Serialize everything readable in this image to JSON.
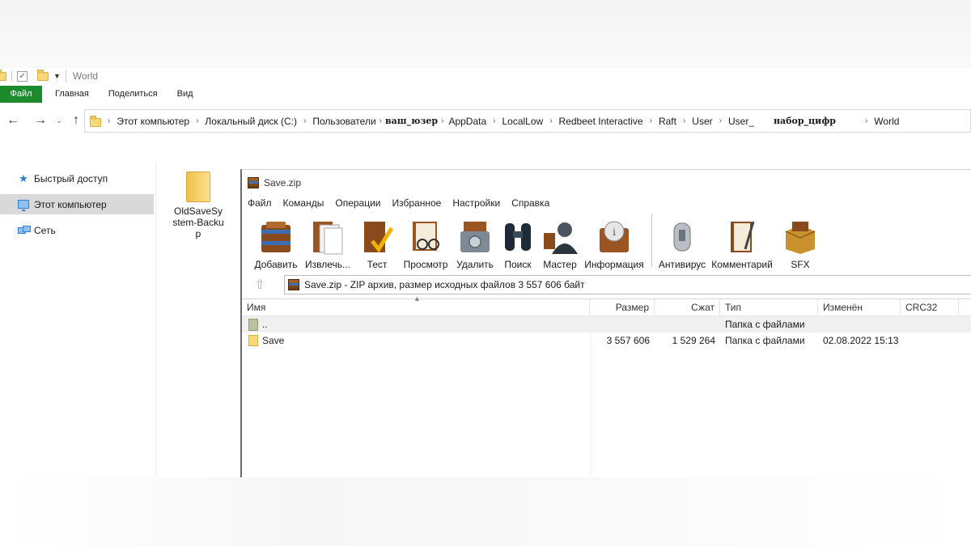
{
  "explorer": {
    "title": "World",
    "ribbon_tabs": [
      "Файл",
      "Главная",
      "Поделиться",
      "Вид"
    ],
    "breadcrumb": [
      "Этот компьютер",
      "Локальный диск (C:)",
      "Пользователи",
      "ваш_юзер",
      "AppData",
      "LocalLow",
      "Redbeet Interactive",
      "Raft",
      "User",
      "User_",
      "набор_цифр",
      "World"
    ],
    "nav_items": [
      "Быстрый доступ",
      "Этот компьютер",
      "Сеть"
    ],
    "folder_item_label": "OldSaveSystem-Backup"
  },
  "rar": {
    "title": "Save.zip",
    "menu": [
      "Файл",
      "Команды",
      "Операции",
      "Избранное",
      "Настройки",
      "Справка"
    ],
    "tools": [
      "Добавить",
      "Извлечь...",
      "Тест",
      "Просмотр",
      "Удалить",
      "Поиск",
      "Мастер",
      "Информация",
      "Антивирус",
      "Комментарий",
      "SFX"
    ],
    "path_text": "Save.zip - ZIP архив, размер исходных файлов 3 557 606 байт",
    "columns": [
      "Имя",
      "Размер",
      "Сжат",
      "Тип",
      "Изменён",
      "CRC32"
    ],
    "rows": [
      {
        "name": "..",
        "size": "",
        "packed": "",
        "type": "Папка с файлами",
        "modified": ""
      },
      {
        "name": "Save",
        "size": "3 557 606",
        "packed": "1 529 264",
        "type": "Папка с файлами",
        "modified": "02.08.2022 15:13"
      }
    ]
  }
}
